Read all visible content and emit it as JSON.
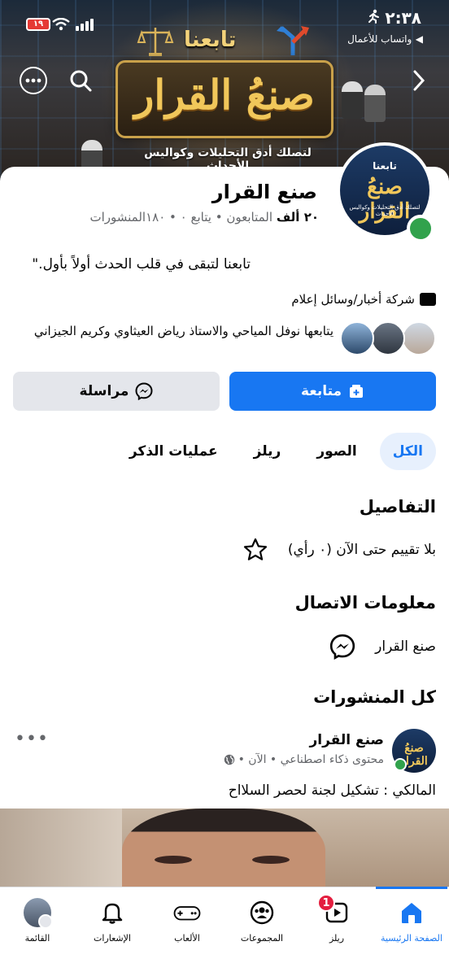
{
  "status_bar": {
    "time": "٢:٣٨",
    "battery": "١٩",
    "back_app": "واتساب للأعمال"
  },
  "cover": {
    "follow_word": "تابعنا",
    "title": "صنعُ القرار",
    "tagline": "لتصلك أدق التحليلات وكواليس الأحداث"
  },
  "avatar": {
    "follow_word": "تابعنا",
    "title": "صنعُ القرار",
    "tagline": "لتصلك أدق التحليلات وكواليس الأحداث"
  },
  "profile": {
    "name": "صنع القرار",
    "followers_count": "٢٠ ألف",
    "followers_label": "المتابعون",
    "following_text": "• يتابع ٠",
    "posts_text": "• ١٨٠المنشورات",
    "bio": "تابعنا لتبقى في قلب الحدث أولاً بأول.\"",
    "category": "شركة أخبار/وسائل إعلام",
    "followed_by": "يتابعها نوفل المياحي والاستاذ رياض العيثاوي وكريم الجيزاني"
  },
  "actions": {
    "follow_label": "متابعة",
    "message_label": "مراسلة"
  },
  "tabs": [
    {
      "label": "الكل",
      "active": true
    },
    {
      "label": "الصور",
      "active": false
    },
    {
      "label": "ريلز",
      "active": false
    },
    {
      "label": "عمليات الذكر",
      "active": false
    }
  ],
  "details": {
    "title": "التفاصيل",
    "rating": "بلا تقييم حتى الآن (٠ رأي)"
  },
  "contact": {
    "title": "معلومات الاتصال",
    "messenger": "صنع القرار"
  },
  "posts": {
    "title": "كل المنشورات",
    "items": [
      {
        "author": "صنع القرار",
        "meta": "محتوى ذكاء اصطناعي • الآن •",
        "avatar_text": "صنعُ القرار",
        "text": "المالكي : تشكيل لجنة لحصر السلااح"
      }
    ]
  },
  "bottom_nav": [
    {
      "label": "الصفحة الرئيسية",
      "icon": "home-icon",
      "active": true
    },
    {
      "label": "ريلز",
      "icon": "reels-icon",
      "badge": "1"
    },
    {
      "label": "المجموعات",
      "icon": "groups-icon"
    },
    {
      "label": "الألعاب",
      "icon": "gaming-icon"
    },
    {
      "label": "الإشعارات",
      "icon": "bell-icon"
    },
    {
      "label": "القائمة",
      "icon": "menu-avatar"
    }
  ],
  "colors": {
    "primary": "#1877f2",
    "online": "#31a24c",
    "badge": "#e41e3f",
    "secondary_button": "#e4e6eb"
  }
}
